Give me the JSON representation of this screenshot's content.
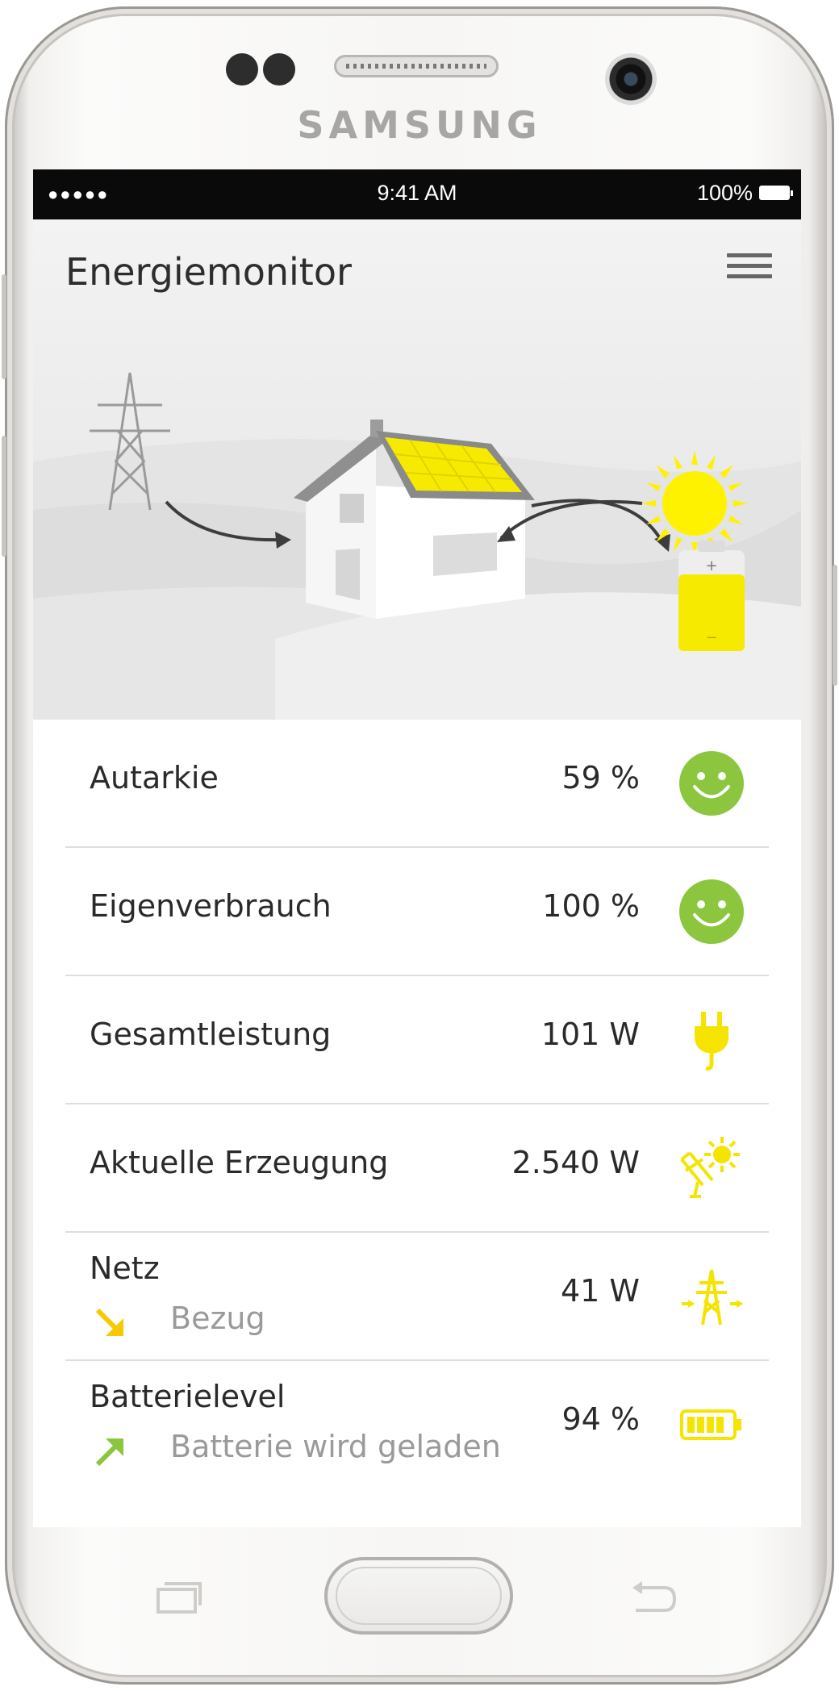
{
  "device": {
    "brand": "SAMSUNG"
  },
  "statusbar": {
    "signal": "●●●●●",
    "time": "9:41 AM",
    "battery": "100%"
  },
  "header": {
    "title": "Energiemonitor",
    "menu_icon": "hamburger-menu-icon"
  },
  "illustration": {
    "icons": [
      "power-tower-icon",
      "house-icon",
      "solar-panel-icon",
      "sun-icon",
      "battery-icon"
    ],
    "battery_symbols": {
      "plus": "+",
      "minus": "−"
    }
  },
  "metrics": [
    {
      "label": "Autarkie",
      "value": "59 %",
      "icon": "smiley-icon",
      "icon_color": "#8cc63f"
    },
    {
      "label": "Eigenverbrauch",
      "value": "100 %",
      "icon": "smiley-icon",
      "icon_color": "#8cc63f"
    },
    {
      "label": "Gesamtleistung",
      "value": "101 W",
      "icon": "plug-icon",
      "icon_color": "#f5e400"
    },
    {
      "label": "Aktuelle Erzeugung",
      "value": "2.540 W",
      "icon": "solar-sun-icon",
      "icon_color": "#f5e400"
    },
    {
      "label": "Netz",
      "sublabel": "Bezug",
      "value": "41 W",
      "icon": "grid-tower-icon",
      "icon_color": "#f5e400",
      "arrow": "arrow-down-right-icon",
      "arrow_color": "#f7c900"
    },
    {
      "label": "Batterielevel",
      "sublabel": "Batterie wird geladen",
      "value": "94 %",
      "icon": "battery-charging-icon",
      "icon_color": "#f5e400",
      "arrow": "arrow-up-right-icon",
      "arrow_color": "#8cc63f"
    }
  ],
  "colors": {
    "accent_yellow": "#f5e400",
    "accent_green": "#8cc63f",
    "text": "#2a2a2a",
    "muted": "#9a9a9a"
  }
}
